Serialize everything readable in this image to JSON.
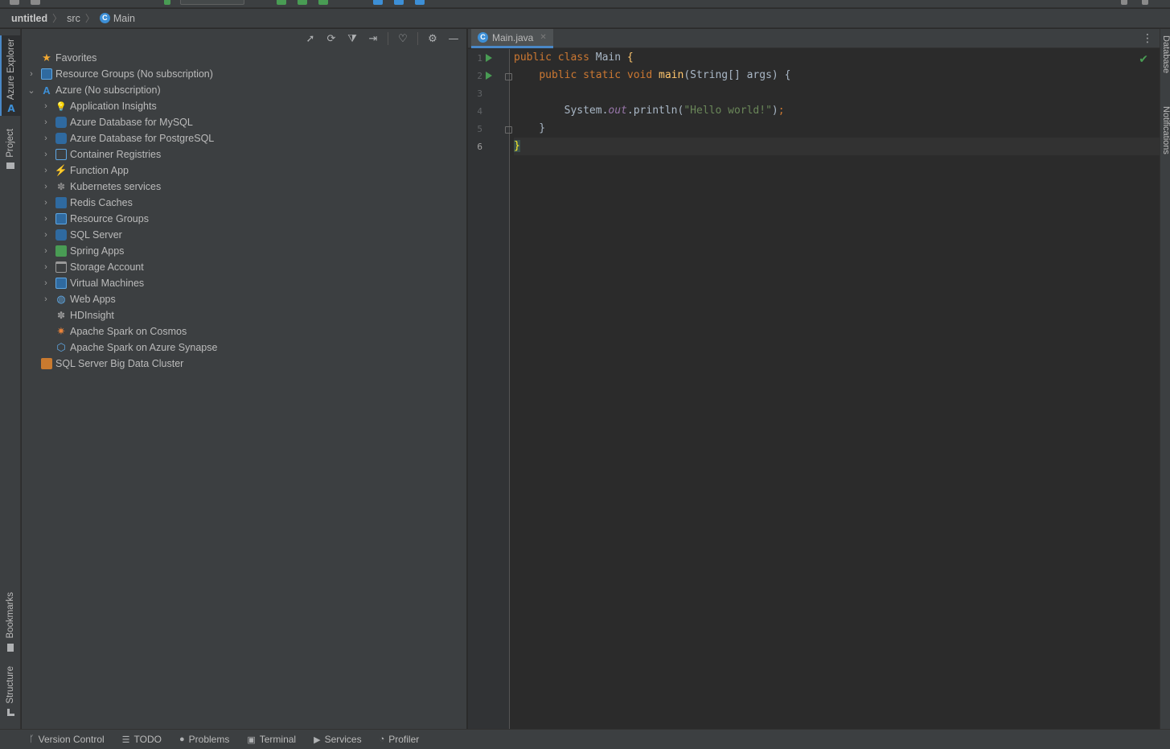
{
  "breadcrumb": {
    "project": "untitled",
    "folder": "src",
    "file": "Main"
  },
  "left_strip": {
    "azure_explorer": "Azure Explorer",
    "project": "Project",
    "bookmarks": "Bookmarks",
    "structure": "Structure"
  },
  "right_strip": {
    "database": "Database",
    "notifications": "Notifications"
  },
  "explorer": {
    "favorites": "Favorites",
    "resource_groups_root": "Resource Groups (No subscription)",
    "azure_root": "Azure (No subscription)",
    "children": [
      "Application Insights",
      "Azure Database for MySQL",
      "Azure Database for PostgreSQL",
      "Container Registries",
      "Function App",
      "Kubernetes services",
      "Redis Caches",
      "Resource Groups",
      "SQL Server",
      "Spring Apps",
      "Storage Account",
      "Virtual Machines",
      "Web Apps",
      "HDInsight",
      "Apache Spark on Cosmos",
      "Apache Spark on Azure Synapse"
    ],
    "big_data": "SQL Server Big Data Cluster"
  },
  "editor": {
    "tab": "Main.java",
    "line_numbers": [
      "1",
      "2",
      "3",
      "4",
      "5",
      "6"
    ]
  },
  "bottom": {
    "version_control": "Version Control",
    "todo": "TODO",
    "problems": "Problems",
    "terminal": "Terminal",
    "services": "Services",
    "profiler": "Profiler"
  },
  "colors": {
    "panel_bg": "#3c3f41",
    "editor_bg": "#2b2b2b",
    "keyword": "#cc7832",
    "method": "#ffc66d",
    "string": "#6a8759",
    "accent": "#4a88c7"
  }
}
